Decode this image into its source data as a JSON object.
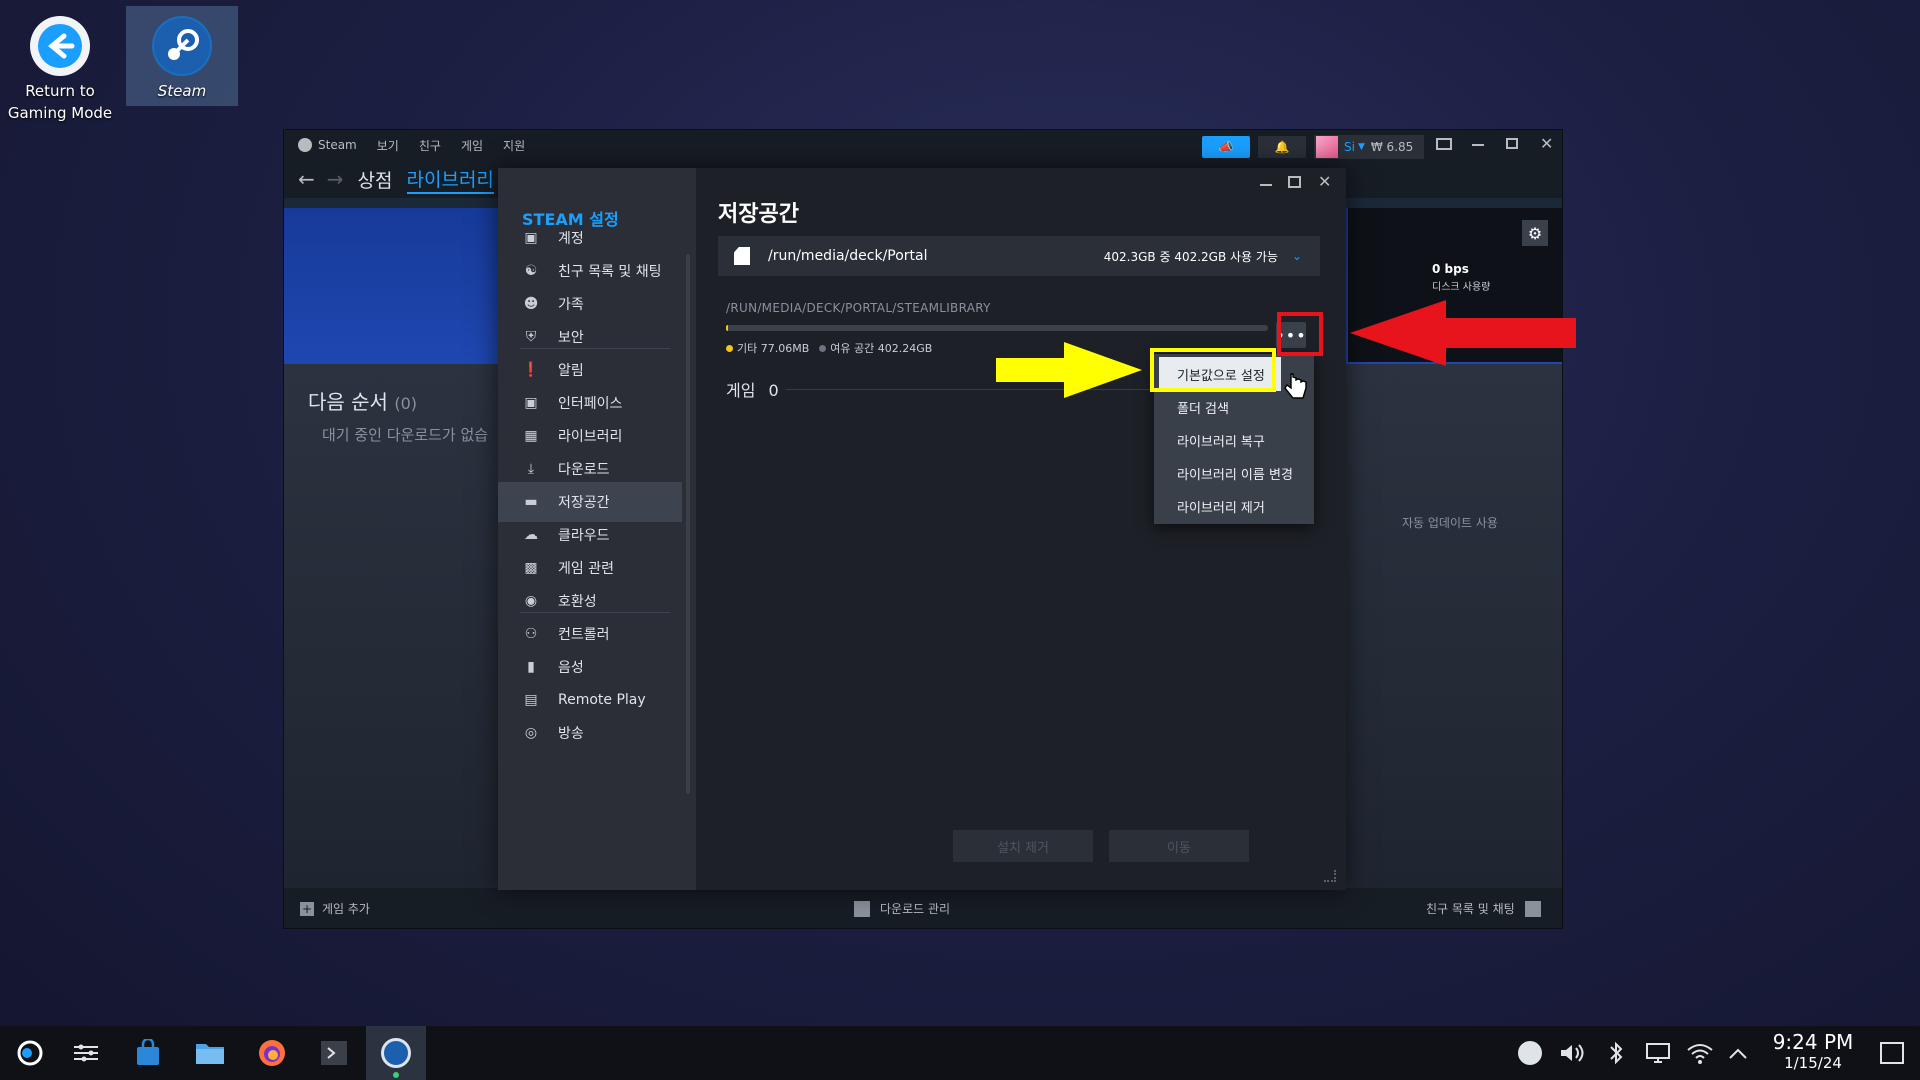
{
  "desktop": {
    "icons": [
      {
        "label_line1": "Return to",
        "label_line2": "Gaming Mode"
      },
      {
        "label_line1": "Steam",
        "label_line2": ""
      }
    ]
  },
  "steam_window": {
    "menu": [
      "Steam",
      "보기",
      "친구",
      "게임",
      "지원"
    ],
    "user_name": "Si",
    "wallet": "₩ 6.85",
    "tabs": [
      "상점",
      "라이브러리"
    ],
    "queue_title": "다음 순서",
    "queue_count": "(0)",
    "queue_empty": "대기 중인 다운로드가 없습",
    "speed": "0 bps",
    "disk_usage_label": "디스크 사용량",
    "auto_update": "자동 업데이트 사용",
    "add_game": "게임 추가",
    "manage_downloads": "다운로드 관리",
    "friends_chat": "친구 목록 및 채팅"
  },
  "settings": {
    "header": "STEAM 설정",
    "sidebar": [
      {
        "label": "계정",
        "icon": "account-card-icon"
      },
      {
        "label": "친구 목록 및 채팅",
        "icon": "friends-icon"
      },
      {
        "label": "가족",
        "icon": "family-icon"
      },
      {
        "label": "보안",
        "icon": "shield-icon"
      },
      {
        "label": "알림",
        "icon": "alert-icon"
      },
      {
        "label": "인터페이스",
        "icon": "monitor-icon"
      },
      {
        "label": "라이브러리",
        "icon": "grid-icon"
      },
      {
        "label": "다운로드",
        "icon": "download-icon"
      },
      {
        "label": "저장공간",
        "icon": "drive-icon"
      },
      {
        "label": "클라우드",
        "icon": "cloud-icon"
      },
      {
        "label": "게임 관련",
        "icon": "game-screen-icon"
      },
      {
        "label": "호환성",
        "icon": "steam-icon"
      },
      {
        "label": "컨트롤러",
        "icon": "gamepad-icon"
      },
      {
        "label": "음성",
        "icon": "microphone-icon"
      },
      {
        "label": "Remote Play",
        "icon": "cast-icon"
      },
      {
        "label": "방송",
        "icon": "broadcast-icon"
      }
    ],
    "active_index": 8,
    "page_title": "저장공간",
    "drive_path": "/run/media/deck/Portal",
    "drive_space": "402.3GB 중 402.2GB 사용 가능",
    "library_path": "/RUN/MEDIA/DECK/PORTAL/STEAMLIBRARY",
    "legend_other": "기타 77.06MB",
    "legend_free": "여유 공간 402.24GB",
    "games_label": "게임",
    "games_count": "0",
    "uninstall": "설치 제거",
    "move": "이동",
    "more_button": "•••"
  },
  "context_menu": {
    "items": [
      "기본값으로 설정",
      "폴더 검색",
      "라이브러리 복구",
      "라이브러리 이름 변경",
      "라이브러리 제거"
    ]
  },
  "taskbar": {
    "time": "9:24 PM",
    "date": "1/15/24"
  },
  "colors": {
    "accent": "#1a9fff",
    "annotation_yellow": "#ffff00",
    "annotation_red": "#e8141c",
    "legend_other": "#f5c518",
    "legend_free": "#6b7280"
  }
}
